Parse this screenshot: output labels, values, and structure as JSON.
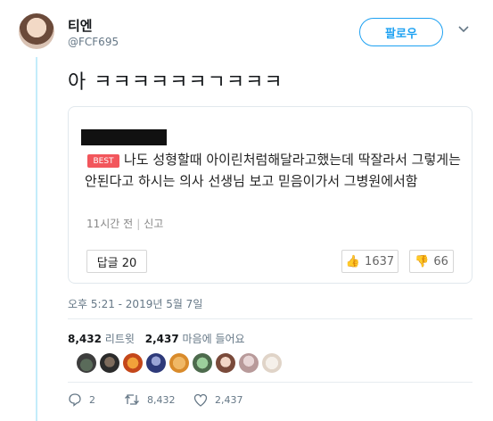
{
  "author": {
    "name": "티엔",
    "handle": "@FCF695",
    "follow_label": "팔로우",
    "menu_icon": "chevron-down-icon"
  },
  "tweet": {
    "text": "아 ㅋㅋㅋㅋㅋㅋㄱㅋㅋㅋ"
  },
  "card": {
    "best_badge": "BEST",
    "comment": "나도 성형할때 아이린처럼해달라고했는데 딱잘라서 그렇게는 안된다고 하시는 의사 선생님 보고 믿음이가서 그병원에서함",
    "time": "11시간 전",
    "report": "신고",
    "reply_label": "답글 20",
    "upvotes": "1637",
    "downvotes": "66"
  },
  "timestamp": "오후 5:21 - 2019년 5월 7일",
  "stats": {
    "retweets": "8,432",
    "retweets_label": "리트윗",
    "likes": "2,437",
    "likes_label": "마음에 들어요"
  },
  "likers_count": 10,
  "actions": {
    "replies": "2",
    "retweets": "8,432",
    "likes": "2,437"
  },
  "colors": {
    "accent": "#1da1f2",
    "best_badge": "#f2565c",
    "thread_line": "#c4ecfb"
  }
}
